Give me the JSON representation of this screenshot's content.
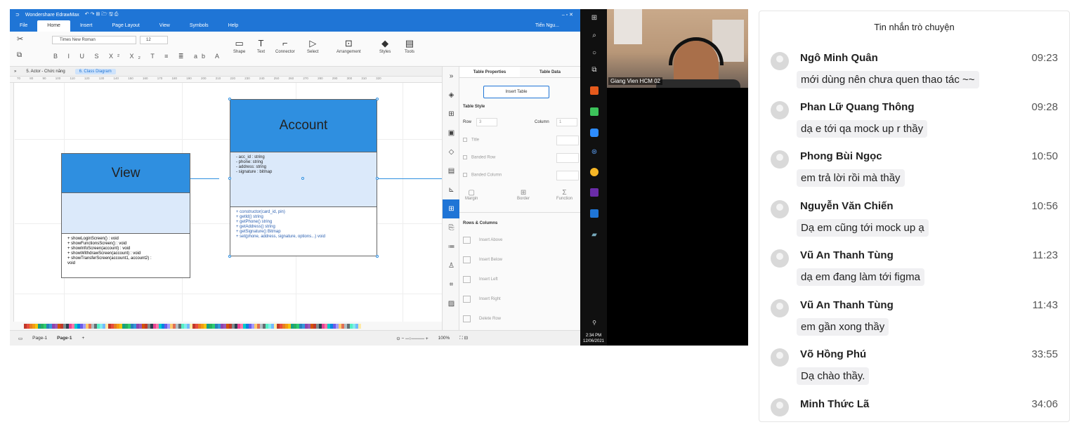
{
  "app": {
    "title": "Wondershare EdrawMax",
    "menu": [
      "File",
      "Home",
      "Insert",
      "Page Layout",
      "View",
      "Symbols",
      "Help"
    ],
    "active_menu": "Home",
    "user": "Tiến Ngu...",
    "font_name": "Times New Roman",
    "font_size": "12",
    "ribbon_buttons": [
      "Shape",
      "Text",
      "Connector",
      "Select",
      "Arrangement",
      "Styles",
      "Tools"
    ],
    "doc_tabs": [
      "5. Actor - Chức năng",
      "6. Class Diagram"
    ],
    "ruler_ticks": [
      "70",
      "80",
      "90",
      "100",
      "110",
      "120",
      "130",
      "140",
      "150",
      "160",
      "170",
      "180",
      "190",
      "200",
      "210",
      "220",
      "230",
      "240",
      "250",
      "260",
      "270",
      "280",
      "290",
      "300",
      "310",
      "320"
    ],
    "pages": [
      "Page-1",
      "Page-1"
    ],
    "zoom": "100%",
    "add_page": "+"
  },
  "diagram": {
    "view_class": {
      "name": "View",
      "ops": [
        "+ showLoginScreen() : void",
        "+ showFunctionsScreen() : void",
        "+ showInfoScreen(account) : void",
        "+ showWithdrawScreen(account) : void",
        "+ showTransferScreen(account1, account2) :",
        "void"
      ]
    },
    "account_class": {
      "name": "Account",
      "attrs": [
        "- acc_id : string",
        "- phone: string",
        "- address: string",
        "- signature : bitmap"
      ],
      "ops": [
        "+ constructor(card_id, pin)",
        "+ getId() string",
        "+ getPhone() string",
        "+ getAddress() string",
        "+ getSignature() Bitmap",
        "+ set(phone, address, signature, options...) void"
      ]
    }
  },
  "panel": {
    "tabs": [
      "Table Properties",
      "Table Data"
    ],
    "insert_table": "Insert Table",
    "table_style": "Table Style",
    "row_label": "Row",
    "row_value": "3",
    "column_label": "Column",
    "column_value": "1",
    "title": "Title",
    "banded_row": "Banded Row",
    "banded_column": "Banded Column",
    "margin": "Margin",
    "border": "Border",
    "function": "Function",
    "rows_columns": "Rows & Columns",
    "actions": [
      "Insert Above",
      "Insert Below",
      "Insert Left",
      "Insert Right",
      "Delete Row"
    ]
  },
  "taskbar": {
    "time": "2:34 PM",
    "date": "12/06/2021"
  },
  "video": {
    "participant": "Giang Vien HCM 02"
  },
  "chat": {
    "title": "Tin nhắn trò chuyện",
    "messages": [
      {
        "sender": "Ngô Minh Quân",
        "time": "09:23",
        "text": "mới dùng nên chưa quen thao tác ~~"
      },
      {
        "sender": "Phan Lữ Quang Thông",
        "time": "09:28",
        "text": "dạ e tới qa mock up r thầy"
      },
      {
        "sender": "Phong Bùi Ngọc",
        "time": "10:50",
        "text": "em trả lời rồi mà thầy"
      },
      {
        "sender": "Nguyễn Văn Chiến",
        "time": "10:56",
        "text": "Dạ em cũng tới mock up ạ"
      },
      {
        "sender": "Vũ An Thanh Tùng",
        "time": "11:23",
        "text": "dạ em đang làm tới figma"
      },
      {
        "sender": "Vũ An Thanh Tùng",
        "time": "11:43",
        "text": "em gần xong thầy"
      },
      {
        "sender": "Võ Hồng Phú",
        "time": "33:55",
        "text": "Dạ chào thầy."
      },
      {
        "sender": "Minh Thức Lã",
        "time": "34:06",
        "text": ""
      }
    ]
  }
}
